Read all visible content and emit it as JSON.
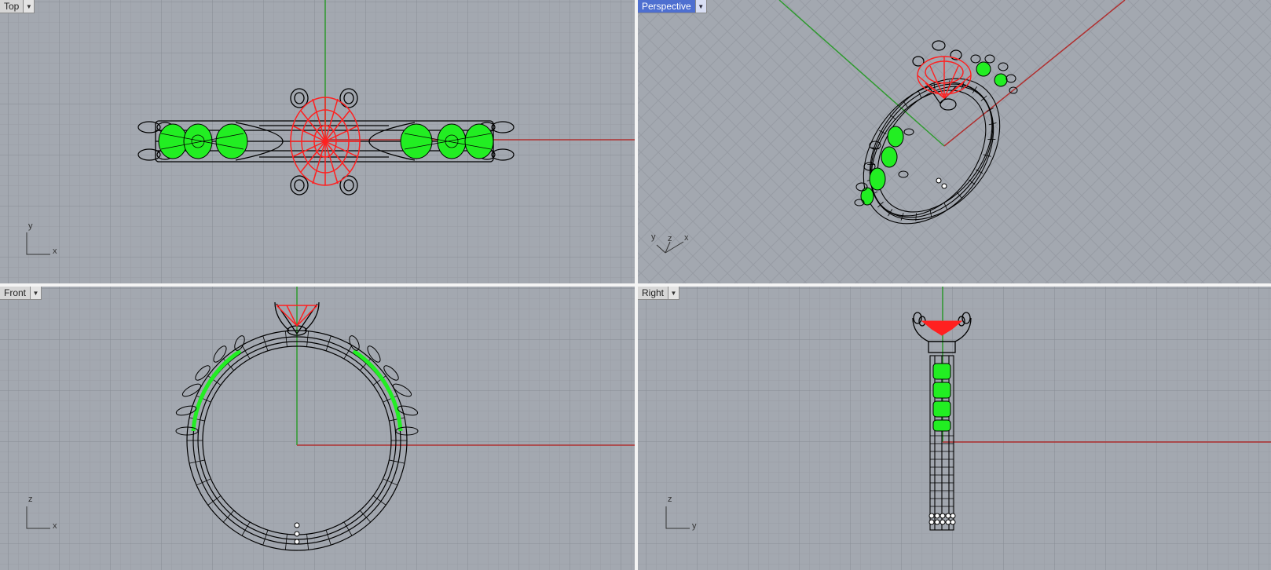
{
  "viewports": {
    "top": {
      "label": "Top",
      "axis_h": "x",
      "axis_v": "y",
      "active": false
    },
    "persp": {
      "label": "Perspective",
      "axis_x": "x",
      "axis_y": "y",
      "axis_z": "z",
      "active": true
    },
    "front": {
      "label": "Front",
      "axis_h": "x",
      "axis_v": "z",
      "active": false
    },
    "right": {
      "label": "Right",
      "axis_h": "y",
      "axis_v": "z",
      "active": false
    }
  },
  "dropdown_icon": "triangle-down-icon",
  "colors": {
    "background": "#a3a8b0",
    "grid_minor": "#9a9fa7",
    "grid_major": "#8a8f97",
    "x_axis": "#b03030",
    "y_axis": "#2e9a2e",
    "wire": "#000000",
    "center_stone": "#ff2020",
    "side_stones": "#22ee22"
  }
}
